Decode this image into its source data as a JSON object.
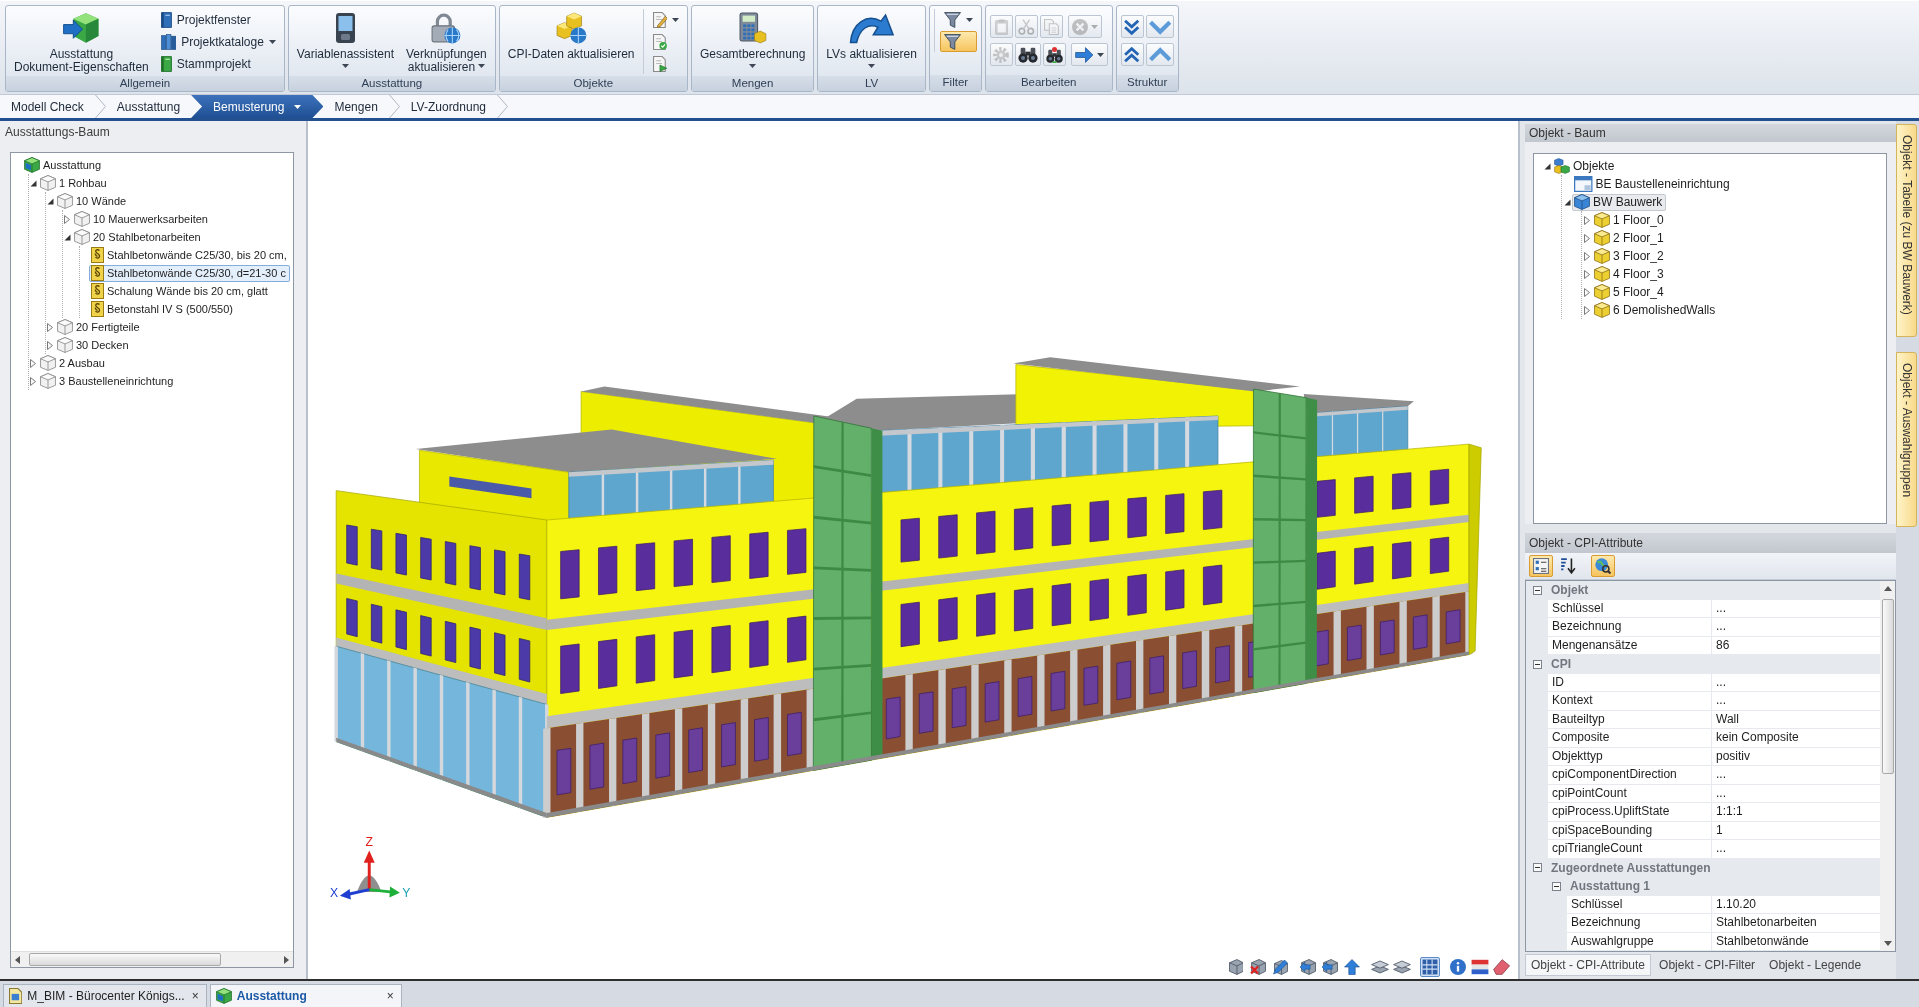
{
  "ribbon": {
    "groups": [
      {
        "label": "Allgemein",
        "items": [
          {
            "kind": "large",
            "lines": [
              "Ausstattung",
              "Dokument-Eigenschaften"
            ],
            "dropdown": false
          },
          {
            "kind": "stack",
            "buttons": [
              {
                "label": "Projektfenster",
                "dropdown": false
              },
              {
                "label": "Projektkataloge",
                "dropdown": true
              },
              {
                "label": "Stammprojekt",
                "dropdown": false
              }
            ]
          }
        ]
      },
      {
        "label": "Ausstattung",
        "items": [
          {
            "kind": "large",
            "lines": [
              "Variablenassistent"
            ],
            "dropdown": true
          },
          {
            "kind": "large",
            "lines": [
              "Verknüpfungen",
              "aktualisieren"
            ],
            "dropdown": true
          }
        ]
      },
      {
        "label": "Objekte",
        "items": [
          {
            "kind": "large",
            "lines": [
              "CPI-Daten aktualisieren"
            ],
            "dropdown": false
          },
          {
            "kind": "stack",
            "buttons": [
              {
                "dropdown": true
              },
              {
                "dropdown": false
              },
              {
                "dropdown": false
              }
            ]
          }
        ]
      },
      {
        "label": "Mengen",
        "items": [
          {
            "kind": "large",
            "lines": [
              "Gesamtberechnung"
            ],
            "dropdown": true
          }
        ]
      },
      {
        "label": "LV",
        "items": [
          {
            "kind": "large",
            "lines": [
              "LVs aktualisieren"
            ],
            "dropdown": true
          }
        ]
      },
      {
        "label": "Filter",
        "items": [
          {
            "kind": "stack",
            "buttons": [
              {
                "dropdown": true,
                "on": false
              },
              {
                "dropdown": false,
                "on": true
              }
            ]
          }
        ]
      },
      {
        "label": "Bearbeiten",
        "items": [
          {
            "kind": "grid",
            "rows": [
              [
                {
                  "disabled": true,
                  "dropdown": false
                },
                {
                  "disabled": true,
                  "dropdown": false
                },
                {
                  "disabled": true,
                  "dropdown": false
                },
                {
                  "disabled": true,
                  "dropdown": true
                }
              ],
              [
                {
                  "disabled": true,
                  "dropdown": false
                },
                {
                  "disabled": false,
                  "dropdown": false
                },
                {
                  "disabled": false,
                  "dropdown": false
                },
                {
                  "disabled": false,
                  "dropdown": true
                }
              ]
            ]
          }
        ]
      },
      {
        "label": "Struktur",
        "items": [
          {
            "kind": "grid",
            "rows": [
              [
                {
                  "disabled": false,
                  "dropdown": false
                },
                {
                  "disabled": false,
                  "dropdown": false
                }
              ],
              [
                {
                  "disabled": false,
                  "dropdown": false
                },
                {
                  "disabled": false,
                  "dropdown": false
                }
              ]
            ]
          }
        ]
      }
    ]
  },
  "crumbs": [
    {
      "label": "Modell Check",
      "selected": false,
      "dropdown": false
    },
    {
      "label": "Ausstattung",
      "selected": false,
      "dropdown": false
    },
    {
      "label": "Bemusterung",
      "selected": true,
      "dropdown": true
    },
    {
      "label": "Mengen",
      "selected": false,
      "dropdown": false
    },
    {
      "label": "LV-Zuordnung",
      "selected": false,
      "dropdown": false
    }
  ],
  "left_panel": {
    "title": "Ausstattungs-Baum",
    "tree": [
      {
        "kind": "root",
        "label": "Ausstattung",
        "selected": false,
        "children": [
          {
            "kind": "folder",
            "label": "1 Rohbau",
            "expanded": true,
            "selected": false,
            "children": [
              {
                "kind": "folder",
                "label": "10 Wände",
                "expanded": true,
                "selected": false,
                "children": [
                  {
                    "kind": "folder",
                    "label": "10 Mauerwerksarbeiten",
                    "expanded": false,
                    "selected": false
                  },
                  {
                    "kind": "folder",
                    "label": "20 Stahlbetonarbeiten",
                    "expanded": true,
                    "selected": false,
                    "children": [
                      {
                        "kind": "item",
                        "label": "Stahlbetonwände C25/30, bis 20 cm,",
                        "selected": false
                      },
                      {
                        "kind": "item",
                        "label": "Stahlbetonwände C25/30, d=21-30 c",
                        "selected": true
                      },
                      {
                        "kind": "item",
                        "label": "Schalung Wände bis 20 cm, glatt",
                        "selected": false
                      },
                      {
                        "kind": "item",
                        "label": "Betonstahl IV S (500/550)",
                        "selected": false
                      }
                    ]
                  }
                ]
              },
              {
                "kind": "folder",
                "label": "20 Fertigteile",
                "expanded": false,
                "selected": false
              },
              {
                "kind": "folder",
                "label": "30 Decken",
                "expanded": false,
                "selected": false
              }
            ]
          },
          {
            "kind": "folder",
            "label": "2 Ausbau",
            "expanded": false,
            "selected": false
          },
          {
            "kind": "folder",
            "label": "3 Baustelleneinrichtung",
            "expanded": false,
            "selected": false
          }
        ]
      }
    ]
  },
  "viewer": {
    "axes": [
      "X",
      "Y",
      "Z"
    ],
    "toolbar": [
      [
        {
          "on": false
        },
        {
          "on": false
        },
        {
          "on": false
        }
      ],
      [
        {
          "on": false
        },
        {
          "on": false
        },
        {
          "on": false
        }
      ],
      [
        {
          "on": false
        },
        {
          "on": false
        }
      ],
      [
        {
          "on": true
        }
      ],
      [
        {
          "on": false
        },
        {
          "on": false
        },
        {
          "on": false
        }
      ]
    ]
  },
  "right_panel": {
    "tree_title": "Objekt - Baum",
    "tree": [
      {
        "kind": "objects",
        "label": "Objekte",
        "expanded": true,
        "selected": false,
        "children": [
          {
            "kind": "site",
            "label": "BE Baustelleneinrichtung",
            "selected": false
          },
          {
            "kind": "building",
            "label": "BW Bauwerk",
            "expanded": true,
            "selected": true,
            "children": [
              {
                "kind": "floor",
                "label": "1 Floor_0",
                "expanded": false,
                "selected": false
              },
              {
                "kind": "floor",
                "label": "2 Floor_1",
                "expanded": false,
                "selected": false
              },
              {
                "kind": "floor",
                "label": "3 Floor_2",
                "expanded": false,
                "selected": false
              },
              {
                "kind": "floor",
                "label": "4 Floor_3",
                "expanded": false,
                "selected": false
              },
              {
                "kind": "floor",
                "label": "5 Floor_4",
                "expanded": false,
                "selected": false
              },
              {
                "kind": "floor",
                "label": "6 DemolishedWalls",
                "expanded": false,
                "selected": false
              }
            ]
          }
        ]
      }
    ],
    "attributes_title": "Objekt - CPI-Attribute",
    "tools": [
      {
        "on": true
      },
      {
        "on": false
      },
      {
        "on": true
      }
    ],
    "groups": [
      {
        "label": "Objekt",
        "expanded": true,
        "rows": [
          {
            "name": "Schlüssel",
            "value": "..."
          },
          {
            "name": "Bezeichnung",
            "value": "..."
          },
          {
            "name": "Mengenansätze",
            "value": "86"
          }
        ]
      },
      {
        "label": "CPI",
        "expanded": true,
        "rows": [
          {
            "name": "ID",
            "value": "..."
          },
          {
            "name": "Kontext",
            "value": "..."
          },
          {
            "name": "Bauteiltyp",
            "value": "Wall"
          },
          {
            "name": "Composite",
            "value": "kein Composite"
          },
          {
            "name": "Objekttyp",
            "value": "positiv"
          },
          {
            "name": "cpiComponentDirection",
            "value": "..."
          },
          {
            "name": "cpiPointCount",
            "value": "..."
          },
          {
            "name": "cpiProcess.UpliftState",
            "value": "1:1:1"
          },
          {
            "name": "cpiSpaceBounding",
            "value": "1"
          },
          {
            "name": "cpiTriangleCount",
            "value": "..."
          }
        ]
      },
      {
        "label": "Zugeordnete Ausstattungen",
        "expanded": true,
        "groups": [
          {
            "label": "Ausstattung 1",
            "expanded": true,
            "rows": [
              {
                "name": "Schlüssel",
                "value": "1.10.20"
              },
              {
                "name": "Bezeichnung",
                "value": "Stahlbetonarbeiten"
              },
              {
                "name": "Auswahlgruppe",
                "value": "Stahlbetonwände"
              }
            ]
          }
        ]
      }
    ],
    "tabs": [
      {
        "label": "Objekt - CPI-Attribute",
        "selected": true
      },
      {
        "label": "Objekt - CPI-Filter",
        "selected": false
      },
      {
        "label": "Objekt - Legende",
        "selected": false
      }
    ]
  },
  "side_tabs": [
    "Objekt - Tabelle (zu BW Bauwerk)",
    "Objekt - Auswahlgruppen"
  ],
  "doc_tabs": [
    {
      "kind": "project",
      "label": "M_BIM - Bürocenter Königs...",
      "selected": false,
      "close": "×"
    },
    {
      "kind": "equipment",
      "label": "Ausstattung",
      "selected": true,
      "close": "×"
    }
  ]
}
